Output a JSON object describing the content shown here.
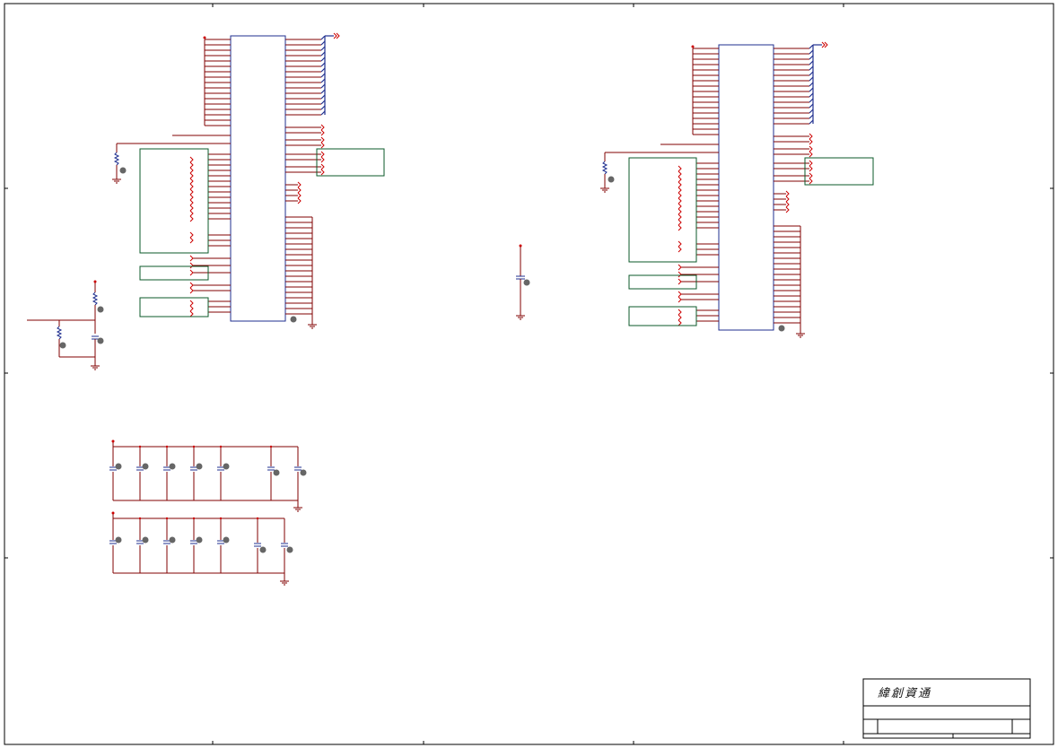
{
  "sheet": {
    "border_color": "#000000",
    "wire_color": "#800000",
    "pin_color": "#cc0000",
    "component_color": "#1f2f8f",
    "block_color": "#0b5a2a",
    "text_marker_color": "#666666"
  },
  "title_block": {
    "company_name": "緯創資通"
  }
}
